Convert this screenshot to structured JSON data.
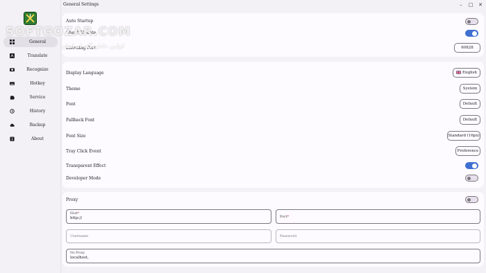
{
  "window": {
    "title": "General Settings",
    "minimize_icon": "minimize-icon",
    "maximize_icon": "maximize-icon",
    "close_icon": "close-icon",
    "minimize_glyph": "–",
    "maximize_glyph": "□",
    "close_glyph": "✕"
  },
  "watermark": {
    "text": "SOFTGOZAR.COM",
    "subtext": "اولین دانلودگاه ایرانیان"
  },
  "sidebar": {
    "logo": "app-logo-icon",
    "items": [
      {
        "label": "General",
        "icon": "grid-icon",
        "active": true
      },
      {
        "label": "Translate",
        "icon": "translate-icon",
        "active": false
      },
      {
        "label": "Recognize",
        "icon": "camera-icon",
        "active": false
      },
      {
        "label": "Hotkey",
        "icon": "keyboard-icon",
        "active": false
      },
      {
        "label": "Service",
        "icon": "puzzle-icon",
        "active": false
      },
      {
        "label": "History",
        "icon": "history-icon",
        "active": false
      },
      {
        "label": "Backup",
        "icon": "cloud-icon",
        "active": false
      },
      {
        "label": "About",
        "icon": "info-icon",
        "active": false
      }
    ]
  },
  "startup": {
    "auto_startup_label": "Auto Startup",
    "auto_startup_on": false,
    "check_update_label": "Check Update",
    "check_update_on": true,
    "listening_port_label": "Listening Port",
    "listening_port_value": "60828"
  },
  "appearance": {
    "display_language_label": "Display Language",
    "display_language_value": "English",
    "display_language_flag": "uk-flag-icon",
    "theme_label": "Theme",
    "theme_value": "System",
    "font_label": "Font",
    "font_value": "Default",
    "fallback_font_label": "Fallback Font",
    "fallback_font_value": "Default",
    "font_size_label": "Font Size",
    "font_size_value": "Standard (16px)",
    "tray_click_label": "Tray Click Event",
    "tray_click_value": "Preference",
    "transparent_label": "Transparent Effect",
    "transparent_on": true,
    "developer_label": "Developer Mode",
    "developer_on": false
  },
  "proxy": {
    "label": "Proxy",
    "enabled": false,
    "host_label": "Host",
    "host_value": "http://",
    "port_label": "Port",
    "required_mark": "*",
    "username_placeholder": "Username",
    "password_placeholder": "Password",
    "no_proxy_label": "No Proxy",
    "no_proxy_value": "localhost,"
  },
  "colors": {
    "accent": "#3f6fd1",
    "background": "#f3f1f5",
    "card": "#fdfbff",
    "logo_green": "#2e7d32"
  }
}
